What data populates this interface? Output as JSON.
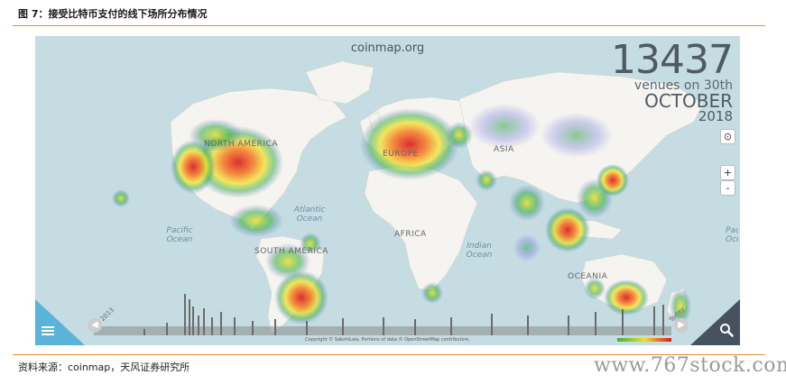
{
  "figure_title": "图 7：接受比特币支付的线下场所分布情况",
  "source": "资料来源：coinmap，天风证券研究所",
  "watermark": "www.767stock.com",
  "map": {
    "site": "coinmap.org",
    "count": "13437",
    "venues_line": "venues on 30th",
    "month": "OCTOBER",
    "year": "2018",
    "timeline_start": "2013",
    "timeline_end": "Today",
    "copyright": "Copyright © SakshiLala. Portions of data © OpenStreetMap contributors.",
    "continents": [
      "NORTH AMERICA",
      "EUROPE",
      "ASIA",
      "AFRICA",
      "SOUTH AMERICA",
      "OCEANIA"
    ],
    "oceans": [
      "Atlantic Ocean",
      "Pacific Ocean",
      "Indian Ocean",
      "Pacific Ocean"
    ],
    "controls": {
      "zoom_in": "+",
      "zoom_out": "-"
    },
    "icons": [
      "locate-icon",
      "menu-icon",
      "search-icon",
      "left-arrow-icon",
      "right-arrow-icon"
    ],
    "colors": {
      "water": "#c4dce2",
      "land": "#f5f4f0",
      "heat_high": "#d7191c",
      "heat_mid": "#f0e020",
      "heat_low": "#3cb04a",
      "accent": "#e1913e"
    }
  }
}
